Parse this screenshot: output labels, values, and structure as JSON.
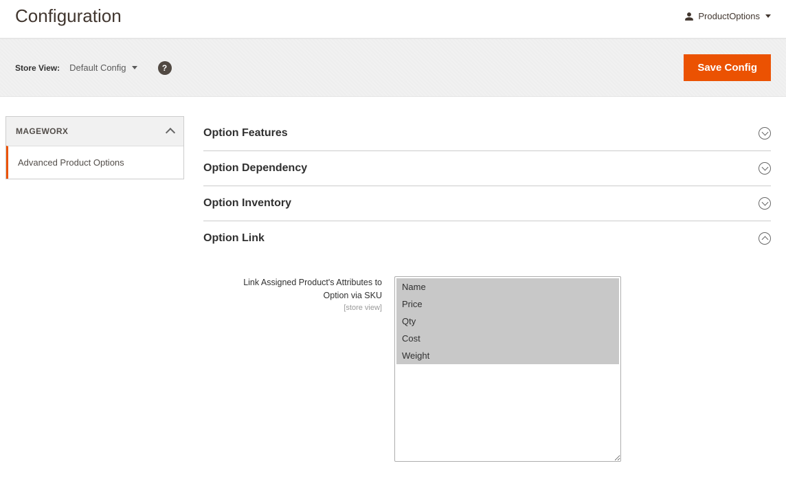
{
  "header": {
    "page_title": "Configuration",
    "user_name": "ProductOptions"
  },
  "actions_bar": {
    "store_view_label": "Store View:",
    "store_view_value": "Default Config",
    "save_button_label": "Save Config"
  },
  "sidebar": {
    "group_label": "MAGEWORX",
    "items": [
      {
        "label": "Advanced Product Options",
        "active": true
      }
    ]
  },
  "accordion_sections": [
    {
      "title": "Option Features",
      "open": false
    },
    {
      "title": "Option Dependency",
      "open": false
    },
    {
      "title": "Option Inventory",
      "open": false
    },
    {
      "title": "Option Link",
      "open": true
    }
  ],
  "option_link_section": {
    "field_label_line1": "Link Assigned Product's Attributes to",
    "field_label_line2": "Option via SKU",
    "scope_label": "[store view]",
    "options": [
      "Name",
      "Price",
      "Qty",
      "Cost",
      "Weight"
    ],
    "selected": [
      "Name",
      "Price",
      "Qty",
      "Cost",
      "Weight"
    ]
  }
}
